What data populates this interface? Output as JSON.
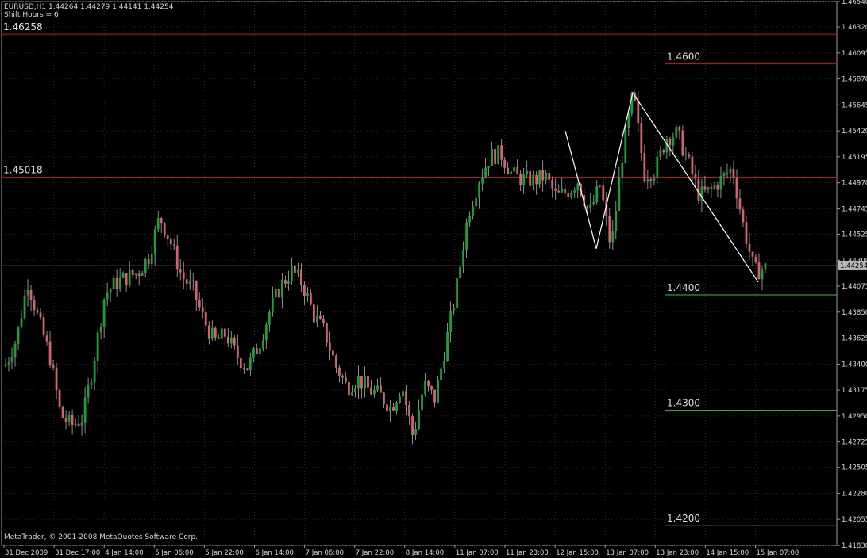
{
  "header": {
    "symbol_line": "EURUSD,H1  1.44264 1.44279 1.44141 1.44254",
    "shift_line": "Shift Hours = 6"
  },
  "copyright": "MetaTrader, © 2001-2008 MetaQuotes Software Corp.",
  "colors": {
    "background": "#000000",
    "grid": "#2a2a2a",
    "bull_candle": "#1e9e3a",
    "bear_candle": "#d4616e",
    "wick": "#b0b0b0",
    "resistance_line": "#d01818",
    "support_line": "#2ecc2e",
    "zigzag": "#ffffff",
    "price_label_bg": "#b8b8b8",
    "axis_text": "#d8d8d8"
  },
  "chart_data": {
    "type": "candlestick",
    "symbol": "EURUSD",
    "timeframe": "H1",
    "ylim": [
      1.4183,
      1.4654
    ],
    "current_price": "1.44254",
    "y_ticks": [
      "1.46540",
      "1.46320",
      "1.46095",
      "1.45870",
      "1.45645",
      "1.45420",
      "1.45195",
      "1.44970",
      "1.44745",
      "1.44525",
      "1.44300",
      "1.44075",
      "1.43850",
      "1.43625",
      "1.43400",
      "1.43175",
      "1.42950",
      "1.42725",
      "1.42505",
      "1.42280",
      "1.42055",
      "1.41830"
    ],
    "x_ticks": [
      "31 Dec 2009",
      "31 Dec 17:00",
      "4 Jan 14:00",
      "5 Jan 06:00",
      "5 Jan 22:00",
      "6 Jan 14:00",
      "7 Jan 06:00",
      "7 Jan 22:00",
      "8 Jan 14:00",
      "11 Jan 07:00",
      "11 Jan 23:00",
      "12 Jan 15:00",
      "13 Jan 07:00",
      "13 Jan 23:00",
      "14 Jan 15:00",
      "15 Jan 07:00"
    ],
    "horizontal_lines": [
      {
        "price": 1.46258,
        "label": "1.46258",
        "kind": "resistance"
      },
      {
        "price": 1.45018,
        "label": "1.45018",
        "kind": "resistance"
      },
      {
        "price": 1.46,
        "label": "1.4600",
        "kind": "resistance"
      },
      {
        "price": 1.44,
        "label": "1.4400",
        "kind": "support"
      },
      {
        "price": 1.43,
        "label": "1.4300",
        "kind": "support"
      },
      {
        "price": 1.42,
        "label": "1.4200",
        "kind": "support"
      }
    ],
    "zigzag_prices": [
      1.4542,
      1.444,
      1.4575,
      1.4411
    ],
    "price_path": [
      1.4339,
      1.4362,
      1.4412,
      1.4378,
      1.4348,
      1.4296,
      1.4287,
      1.4293,
      1.4342,
      1.44,
      1.441,
      1.4415,
      1.4419,
      1.4433,
      1.4468,
      1.4445,
      1.4416,
      1.4405,
      1.4378,
      1.4359,
      1.4366,
      1.4347,
      1.4337,
      1.4357,
      1.4386,
      1.4408,
      1.4421,
      1.4409,
      1.4382,
      1.4367,
      1.4338,
      1.432,
      1.4327,
      1.4318,
      1.4313,
      1.4302,
      1.4322,
      1.4277,
      1.4322,
      1.431,
      1.4358,
      1.4408,
      1.447,
      1.45,
      1.452,
      1.4522,
      1.4504,
      1.45,
      1.4499,
      1.4503,
      1.4485,
      1.4489,
      1.4499,
      1.447,
      1.4495,
      1.444,
      1.452,
      1.4575,
      1.4505,
      1.4508,
      1.4536,
      1.454,
      1.4515,
      1.4486,
      1.449,
      1.45,
      1.451,
      1.446,
      1.442,
      1.4423
    ]
  }
}
